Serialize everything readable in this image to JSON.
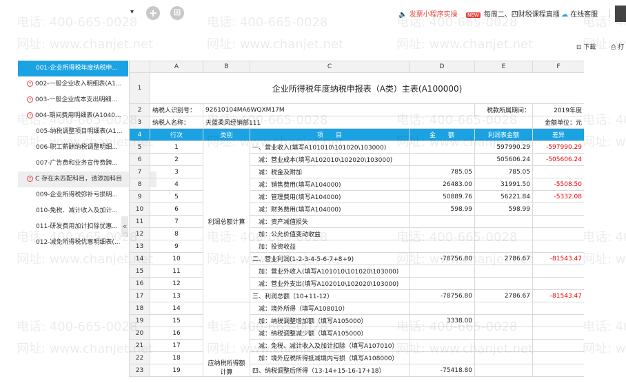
{
  "topbar": {
    "promo_text": "发票小程序实操",
    "live_text": "每周二、四财税课程直播",
    "live_badge": "NEW",
    "service_text": "在线客服",
    "plus_glyph": "+",
    "grid_glyph": "⊞",
    "dropdown_glyph": "▾"
  },
  "toolbar": {
    "download": "下载",
    "print": "打"
  },
  "watermark": {
    "phone": "电话: 400-665-0028",
    "site": "网址: www.chanjet.net"
  },
  "sidebar": {
    "items": [
      {
        "label": "001-企业所得税年度纳税申...",
        "state": "active"
      },
      {
        "label": "002-一般企业收入明细表(A1...",
        "state": "warn"
      },
      {
        "label": "003-一般企业成本支出明细...",
        "state": "warn"
      },
      {
        "label": "004-期间费用明细表(A1040...",
        "state": "warn"
      },
      {
        "label": "005-纳税调整项目明细表(A1...",
        "state": ""
      },
      {
        "label": "006-职工薪酬纳税调整明细...",
        "state": ""
      },
      {
        "label": "007-广告费和业务宣传费跨...",
        "state": ""
      },
      {
        "label": "C  存在未匹配科目，请添加科目",
        "state": "hint"
      },
      {
        "label": "009-企业所得税弥补亏损明...",
        "state": ""
      },
      {
        "label": "010-免税、减计收入及加计...",
        "state": ""
      },
      {
        "label": "011-研发费用加计扣除优惠...",
        "state": ""
      },
      {
        "label": "012-减免所得税优惠明细表(...",
        "state": ""
      }
    ],
    "collapse_glyph": "«"
  },
  "sheet": {
    "columns": [
      "A",
      "B",
      "C",
      "D",
      "E",
      "F"
    ],
    "title": "企业所得税年度纳税申报表（A类）主表(A100000)",
    "taxpayer_id_label": "纳税人识别号：",
    "taxpayer_id": "92610104MA6WQXM17M",
    "period_label": "税款所属期间：",
    "period_value": "2019年度",
    "taxpayer_name_label": "纳税人名称：",
    "taxpayer_name": "天蓝柔风经销部111",
    "unit_label": "金额单位：元",
    "headers": [
      "行次",
      "类别",
      "项　　目",
      "金　　额",
      "利润表金额",
      "差异"
    ],
    "category_profit": "利润总额计算",
    "category_taxable": "应纳税所得额计算",
    "rows": [
      {
        "n": "5",
        "line": "1",
        "item": "一、营业收入(填写A101010\\101020\\103000)",
        "amount": "",
        "profit": "597990.29",
        "diff": "-597990.29"
      },
      {
        "n": "6",
        "line": "2",
        "item": "　减：营业成本(填写A102010\\102020\\103000)",
        "amount": "",
        "profit": "505606.24",
        "diff": "-505606.24"
      },
      {
        "n": "7",
        "line": "3",
        "item": "　减：税金及附加",
        "amount": "785.05",
        "profit": "785.05",
        "diff": ""
      },
      {
        "n": "8",
        "line": "4",
        "item": "　减：销售费用(填写A104000)",
        "amount": "26483.00",
        "profit": "31991.50",
        "diff": "-5508.50"
      },
      {
        "n": "9",
        "line": "5",
        "item": "　减：管理费用(填写A104000)",
        "amount": "50889.76",
        "profit": "56221.84",
        "diff": "-5332.08"
      },
      {
        "n": "10",
        "line": "6",
        "item": "　减：财务费用(填写A104000)",
        "amount": "598.99",
        "profit": "598.99",
        "diff": ""
      },
      {
        "n": "11",
        "line": "7",
        "item": "　减：资产减值损失",
        "amount": "",
        "profit": "",
        "diff": ""
      },
      {
        "n": "12",
        "line": "8",
        "item": "　加：公允价值变动收益",
        "amount": "",
        "profit": "",
        "diff": ""
      },
      {
        "n": "13",
        "line": "9",
        "item": "　加：投资收益",
        "amount": "",
        "profit": "",
        "diff": ""
      },
      {
        "n": "14",
        "line": "10",
        "item": "二、营业利润(1-2-3-4-5-6-7+8+9)",
        "amount": "-78756.80",
        "profit": "2786.67",
        "diff": "-81543.47"
      },
      {
        "n": "15",
        "line": "11",
        "item": "　加：营业外收入(填写A101010\\101020\\103000)",
        "amount": "",
        "profit": "",
        "diff": ""
      },
      {
        "n": "16",
        "line": "12",
        "item": "　减：营业外支出(填写A102010\\102020\\103000)",
        "amount": "",
        "profit": "",
        "diff": ""
      },
      {
        "n": "17",
        "line": "13",
        "item": "三、利润总额（10+11-12）",
        "amount": "-78756.80",
        "profit": "2786.67",
        "diff": "-81543.47"
      },
      {
        "n": "18",
        "line": "14",
        "item": "　减：境外所得（填写A108010）",
        "amount": "",
        "profit": "",
        "diff": ""
      },
      {
        "n": "19",
        "line": "15",
        "item": "　加：纳税调整增加额（填写A105000）",
        "amount": "3338.00",
        "profit": "",
        "diff": ""
      },
      {
        "n": "20",
        "line": "16",
        "item": "　减：纳税调整减少额（填写A105000）",
        "amount": "",
        "profit": "",
        "diff": ""
      },
      {
        "n": "21",
        "line": "17",
        "item": "　减：免税、减计收入及加计扣除（填写A107010）",
        "amount": "",
        "profit": "",
        "diff": ""
      },
      {
        "n": "22",
        "line": "18",
        "item": "　加：境外应税所得抵减境内亏损（填写A108000）",
        "amount": "",
        "profit": "",
        "diff": ""
      },
      {
        "n": "23",
        "line": "19",
        "item": "四、纳税调整后所得（13-14+15-16-17+18）",
        "amount": "-75418.80",
        "profit": "",
        "diff": ""
      }
    ]
  },
  "colors": {
    "accent": "#1ba2e3",
    "negative": "#e00000",
    "warn": "#e8463b"
  }
}
